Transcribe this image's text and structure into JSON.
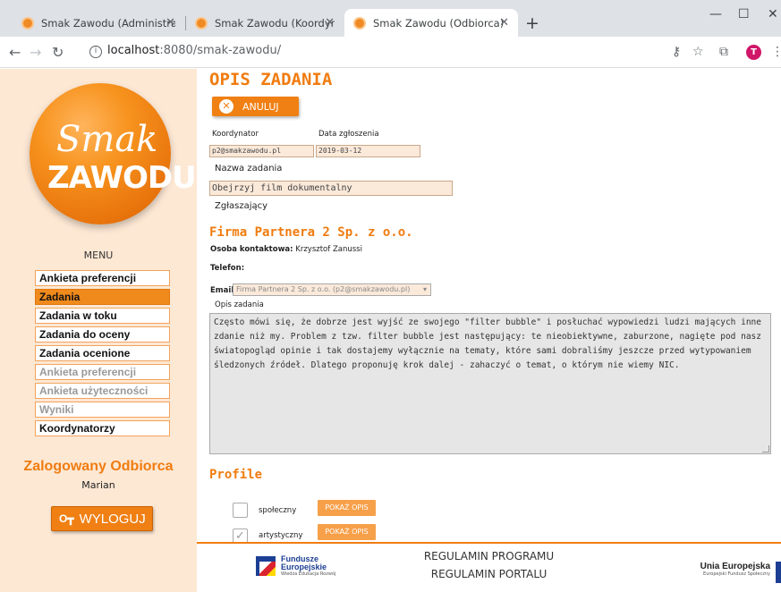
{
  "browser": {
    "tabs": [
      {
        "title": "Smak Zawodu (Administrator)",
        "active": false
      },
      {
        "title": "Smak Zawodu (Koordynator)",
        "active": false
      },
      {
        "title": "Smak Zawodu (Odbiorca)",
        "active": true
      }
    ],
    "url_host": "localhost",
    "url_rest": ":8080/smak-zawodu/",
    "avatar_letter": "T"
  },
  "logo": {
    "line1": "Smak",
    "line2": "ZAWODU"
  },
  "menu": {
    "title": "MENU",
    "items": [
      {
        "label": "Ankieta preferencji",
        "state": "normal"
      },
      {
        "label": "Zadania",
        "state": "active"
      },
      {
        "label": "Zadania w toku",
        "state": "normal"
      },
      {
        "label": "Zadania do oceny",
        "state": "normal"
      },
      {
        "label": "Zadania ocenione",
        "state": "normal"
      },
      {
        "label": "Ankieta preferencji",
        "state": "dim"
      },
      {
        "label": "Ankieta użyteczności",
        "state": "dim"
      },
      {
        "label": "Wyniki",
        "state": "dim"
      },
      {
        "label": "Koordynatorzy",
        "state": "normal"
      }
    ]
  },
  "session": {
    "logged_label": "Zalogowany Odbiorca",
    "user_name": "Marian",
    "logout_label": "WYLOGUJ"
  },
  "page": {
    "title": "OPIS ZADANIA",
    "cancel_label": "ANULUJ",
    "coordinator_label": "Koordynator",
    "coordinator_value": "p2@smakzawodu.pl",
    "date_label": "Data zgłoszenia",
    "date_value": "2019-03-12",
    "task_name_label": "Nazwa zadania",
    "task_name_value": "Obejrzyj film dokumentalny",
    "reporter_label": "Zgłaszający",
    "firm_name": "Firma Partnera 2 Sp. z o.o.",
    "contact_label": "Osoba kontaktowa:",
    "contact_value": "Krzysztof Zanussi",
    "phone_label": "Telefon:",
    "email_label": "Email:",
    "email_value": "Firma Partnera 2 Sp. z o.o. (p2@smakzawodu.pl)",
    "desc_label": "Opis zadania",
    "desc_value": "Często mówi się, że dobrze jest wyjść ze swojego \"filter bubble\" i posłuchać wypowiedzi ludzi mających inne zdanie niż my. Problem z tzw. filter bubble jest następujący: te nieobiektywne, zaburzone, nagięte pod nasz światopogląd opinie i tak dostajemy wyłącznie na tematy, które sami dobraliśmy jeszcze przed wytypowaniem śledzonych źródeł. Dlatego proponuję krok dalej - zahaczyć o temat, o którym nie wiemy NIC.",
    "profiles_title": "Profile",
    "profiles": [
      {
        "label": "społeczny",
        "checked": false,
        "button": "POKAŻ OPIS"
      },
      {
        "label": "artystyczny",
        "checked": true,
        "button": "POKAŻ OPIS"
      }
    ]
  },
  "footer": {
    "link1": "REGULAMIN PROGRAMU",
    "link2": "REGULAMIN PORTALU",
    "fe_line1": "Fundusze",
    "fe_line2": "Europejskie",
    "fe_line3": "Wiedza Edukacja Rozwój",
    "ue_line1": "Unia Europejska",
    "ue_line2": "Europejski Fundusz Społeczny"
  },
  "colors": {
    "accent": "#f07c10",
    "sidebar_bg": "#fde8d4",
    "field_bg": "#fbe9da"
  }
}
